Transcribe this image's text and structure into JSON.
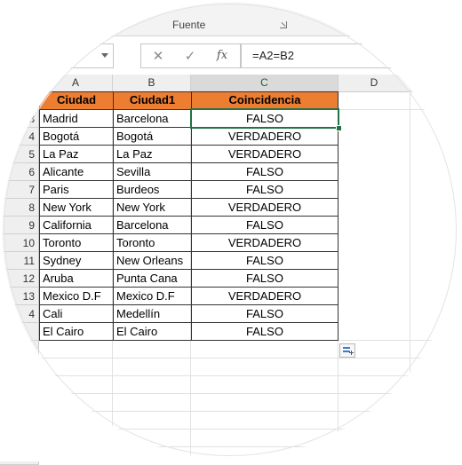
{
  "ribbon": {
    "group_label": "Fuente"
  },
  "formula_bar": {
    "cancel_glyph": "✕",
    "enter_glyph": "✓",
    "fx_label": "fx",
    "formula": "=A2=B2"
  },
  "columns": [
    "A",
    "B",
    "C",
    "D"
  ],
  "rows": [
    "",
    "3",
    "4",
    "5",
    "6",
    "7",
    "8",
    "9",
    "10",
    "11",
    "12",
    "13",
    "4"
  ],
  "table": {
    "headers": [
      "Ciudad",
      "Ciudad1",
      "Coincidencia"
    ],
    "rows": [
      [
        "Madrid",
        "Barcelona",
        "FALSO"
      ],
      [
        "Bogotá",
        "Bogotá",
        "VERDADERO"
      ],
      [
        "La Paz",
        "La Paz",
        "VERDADERO"
      ],
      [
        "Alicante",
        "Sevilla",
        "FALSO"
      ],
      [
        "Paris",
        "Burdeos",
        "FALSO"
      ],
      [
        "New York",
        "New York",
        "VERDADERO"
      ],
      [
        "California",
        "Barcelona",
        "FALSO"
      ],
      [
        "Toronto",
        "Toronto",
        "VERDADERO"
      ],
      [
        "Sydney",
        "New Orleans",
        "FALSO"
      ],
      [
        "Aruba",
        "Punta Cana",
        "FALSO"
      ],
      [
        "Mexico D.F",
        "Mexico D.F",
        "VERDADERO"
      ],
      [
        "Cali",
        "Medellín",
        "FALSO"
      ],
      [
        "El Cairo",
        "El Cairo",
        "FALSO"
      ]
    ]
  },
  "colors": {
    "header_fill": "#ed7d31",
    "selection": "#217346"
  },
  "icons": {
    "quick_analysis": "quick-analysis-icon",
    "dialog_launcher": "dialog-launcher-icon",
    "dropdown": "chevron-down-icon"
  }
}
